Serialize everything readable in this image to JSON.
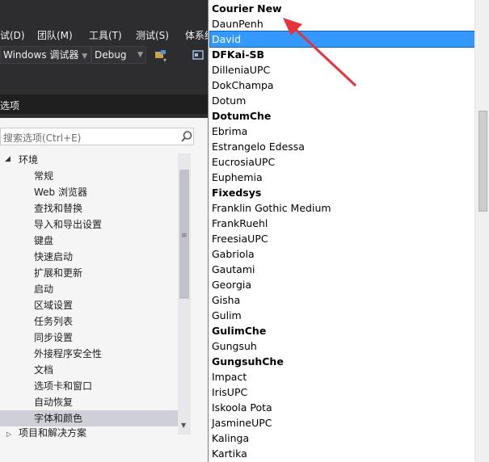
{
  "menu": {
    "items": [
      "试(D)",
      "团队(M)",
      "工具(T)",
      "测试(S)",
      "体系结"
    ],
    "debugger_target": "Windows 调试器",
    "configuration": "Debug"
  },
  "dialog": {
    "title": "选项",
    "search_placeholder": "搜索选项(Ctrl+E)",
    "tree": [
      "环境",
      "常规",
      "Web 浏览器",
      "查找和替换",
      "导入和导出设置",
      "键盘",
      "快速启动",
      "扩展和更新",
      "启动",
      "区域设置",
      "任务列表",
      "同步设置",
      "外接程序安全性",
      "文档",
      "选项卡和窗口",
      "自动恢复",
      "字体和颜色",
      "项目和解决方案"
    ]
  },
  "font_list": {
    "selected": "David",
    "items": [
      {
        "name": "Courier New",
        "bold": true
      },
      {
        "name": "DaunPenh",
        "bold": false
      },
      {
        "name": "David",
        "bold": false
      },
      {
        "name": "DFKai-SB",
        "bold": true
      },
      {
        "name": "DilleniaUPC",
        "bold": false
      },
      {
        "name": "DokChampa",
        "bold": false
      },
      {
        "name": "Dotum",
        "bold": false
      },
      {
        "name": "DotumChe",
        "bold": true
      },
      {
        "name": "Ebrima",
        "bold": false
      },
      {
        "name": "Estrangelo Edessa",
        "bold": false
      },
      {
        "name": "EucrosiaUPC",
        "bold": false
      },
      {
        "name": "Euphemia",
        "bold": false
      },
      {
        "name": "Fixedsys",
        "bold": true
      },
      {
        "name": "Franklin Gothic Medium",
        "bold": false
      },
      {
        "name": "FrankRuehl",
        "bold": false
      },
      {
        "name": "FreesiaUPC",
        "bold": false
      },
      {
        "name": "Gabriola",
        "bold": false
      },
      {
        "name": "Gautami",
        "bold": false
      },
      {
        "name": "Georgia",
        "bold": false
      },
      {
        "name": "Gisha",
        "bold": false
      },
      {
        "name": "Gulim",
        "bold": false
      },
      {
        "name": "GulimChe",
        "bold": true
      },
      {
        "name": "Gungsuh",
        "bold": false
      },
      {
        "name": "GungsuhChe",
        "bold": true
      },
      {
        "name": "Impact",
        "bold": false
      },
      {
        "name": "IrisUPC",
        "bold": false
      },
      {
        "name": "Iskoola Pota",
        "bold": false
      },
      {
        "name": "JasmineUPC",
        "bold": false
      },
      {
        "name": "Kalinga",
        "bold": false
      },
      {
        "name": "Kartika",
        "bold": false
      }
    ]
  },
  "annotation": {
    "color": "#e8333a"
  }
}
